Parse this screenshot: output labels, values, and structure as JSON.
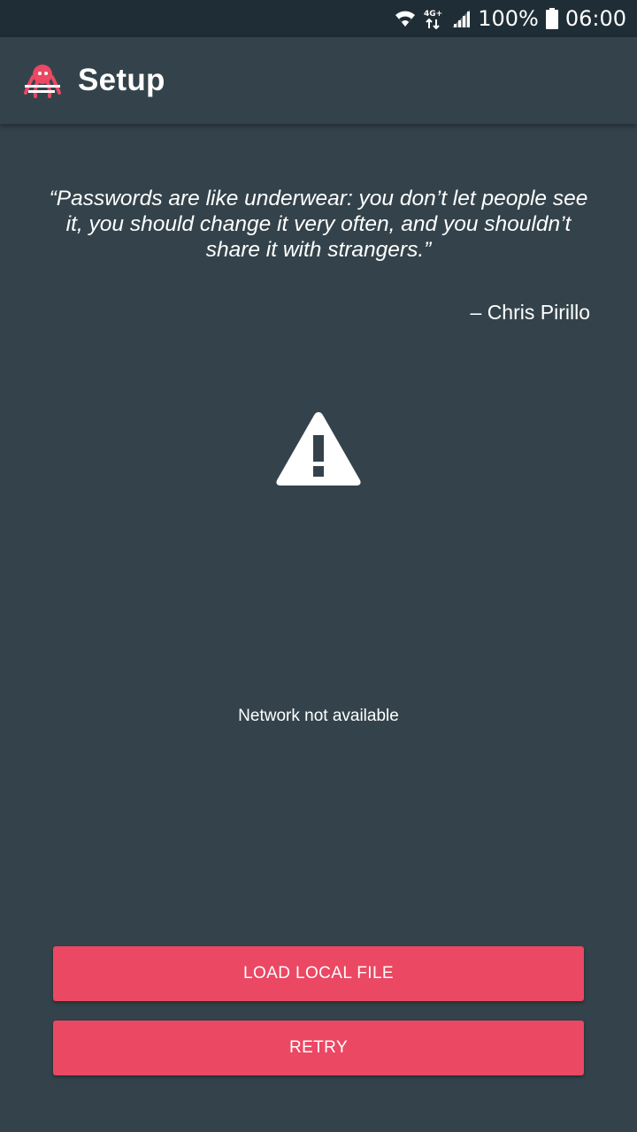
{
  "status_bar": {
    "battery_percent": "100%",
    "time": "06:00",
    "network_type": "4G+",
    "icons": [
      "wifi-icon",
      "mobile-data-icon",
      "signal-icon",
      "battery-icon"
    ]
  },
  "app_bar": {
    "title": "Setup",
    "logo_icon": "octopus-logo-icon"
  },
  "quote": {
    "text": "“Passwords are like underwear: you don’t let people see it, you should change it very often, and you shouldn’t share it with strangers.”",
    "author": "– Chris Pirillo"
  },
  "status": {
    "icon": "warning-icon",
    "message": "Network not available"
  },
  "buttons": {
    "load_local_file": "LOAD LOCAL FILE",
    "retry": "RETRY"
  },
  "colors": {
    "background": "#34434b",
    "status_bar": "#1f2d36",
    "accent": "#ea4863"
  }
}
